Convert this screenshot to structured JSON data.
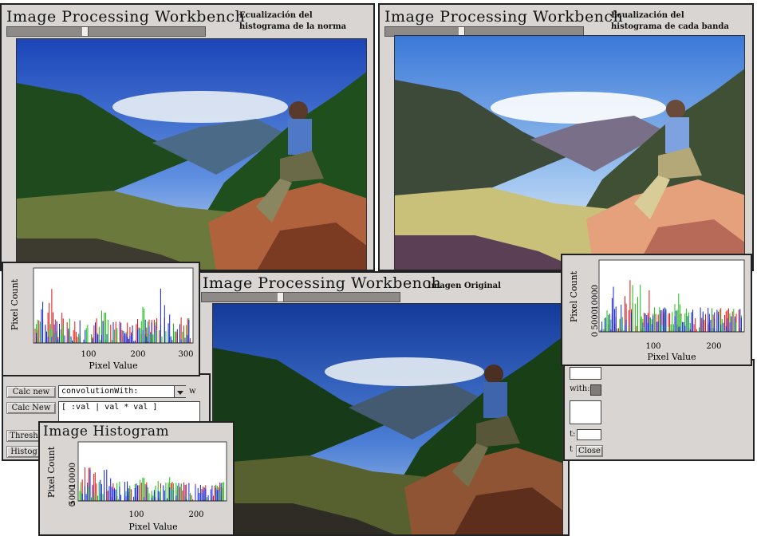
{
  "windows": {
    "top_left": {
      "title": "Image Processing Workbench",
      "caption": [
        "Ecualización del",
        "histograma de la norma"
      ],
      "slider_value": 0.4
    },
    "top_right": {
      "title": "Image Processing Workbench",
      "caption": [
        "Ecualización del",
        "histograma de cada banda"
      ],
      "slider_value": 0.37
    },
    "center": {
      "title": "Image Processing Workbench",
      "caption": [
        "Imagen Original"
      ],
      "slider_value": 0.38
    }
  },
  "histogram_top_left": {
    "ylabel": "Pixel Count",
    "xlabel": "Pixel Value",
    "xticks": [
      "100",
      "200",
      "300"
    ],
    "yticks": [
      "",
      "",
      "",
      "",
      "",
      ""
    ]
  },
  "histogram_top_right": {
    "ylabel": "Pixel Count",
    "xlabel": "Pixel Value",
    "xticks": [
      "100",
      "200"
    ],
    "yticks": [
      "10000",
      "5000",
      "0"
    ]
  },
  "histogram_bottom": {
    "title": "Image Histogram",
    "ylabel": "Pixel Count",
    "xlabel": "Pixel Value",
    "xticks": [
      "100",
      "200"
    ],
    "yticks": [
      "10000",
      "5000",
      "0"
    ]
  },
  "controls": {
    "calc_new_1": "Calc new",
    "calc_new_2": "Calc New",
    "thresh": "Thresh",
    "histog": "Histog",
    "dropdown_value": "convolutionWith:",
    "code_value": "[ :val | val * val ]",
    "w_label": "w",
    "with_label": "with:",
    "t_label": "t:",
    "close_label": "Close",
    "partial_label": "t"
  },
  "chart_data": [
    {
      "type": "bar",
      "title": "",
      "xlabel": "Pixel Value",
      "ylabel": "Pixel Count",
      "xlim": [
        0,
        310
      ],
      "series": [
        {
          "name": "",
          "color": "#e01010"
        },
        {
          "name": "",
          "color": "#10c010"
        },
        {
          "name": "",
          "color": "#1020e0"
        }
      ],
      "note_values": "spiky histogram, blue peak near 250, red peaks near 40"
    },
    {
      "type": "bar",
      "title": "",
      "xlabel": "Pixel Value",
      "ylabel": "Pixel Count",
      "xlim": [
        0,
        255
      ],
      "ylim": [
        0,
        15000
      ],
      "series": [
        {
          "name": "",
          "color": "#e01010"
        },
        {
          "name": "",
          "color": "#10c010"
        },
        {
          "name": "",
          "color": "#1020e0"
        }
      ]
    },
    {
      "type": "bar",
      "title": "Image Histogram",
      "xlabel": "Pixel Value",
      "ylabel": "Pixel Count",
      "xlim": [
        0,
        255
      ],
      "ylim": [
        0,
        15000
      ],
      "series": [
        {
          "name": "",
          "color": "#e01010"
        },
        {
          "name": "",
          "color": "#10c010"
        },
        {
          "name": "",
          "color": "#1020e0"
        }
      ]
    }
  ]
}
